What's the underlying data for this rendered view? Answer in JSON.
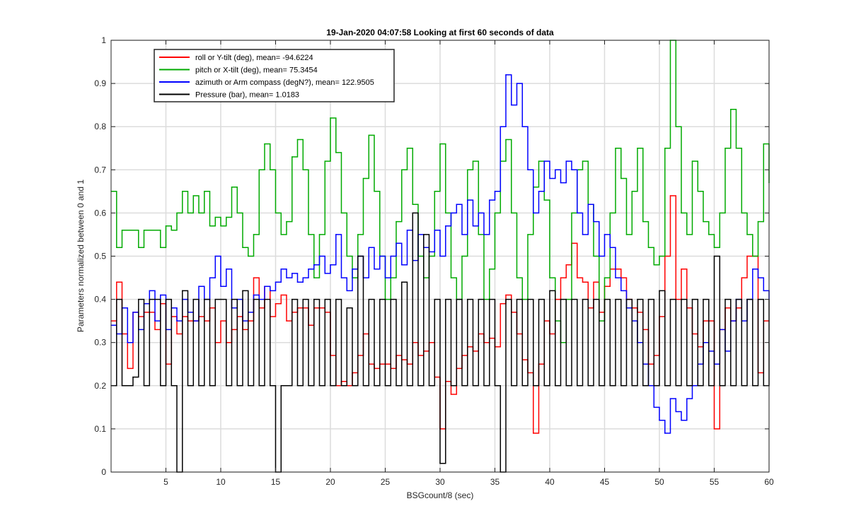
{
  "chart_data": {
    "type": "line",
    "title": "19-Jan-2020 04:07:58 Looking at first 60 seconds of data",
    "xlabel": "BSGcount/8 (sec)",
    "ylabel": "Parameters normalized between 0 and 1",
    "xlim": [
      0,
      60
    ],
    "ylim": [
      0,
      1
    ],
    "xticks": [
      5,
      10,
      15,
      20,
      25,
      30,
      35,
      40,
      45,
      50,
      55,
      60
    ],
    "yticks": [
      0,
      0.1,
      0.2,
      0.3,
      0.4,
      0.5,
      0.6,
      0.7,
      0.8,
      0.9,
      1
    ],
    "xtick_labels": [
      "5",
      "10",
      "15",
      "20",
      "25",
      "30",
      "35",
      "40",
      "45",
      "50",
      "55",
      "60"
    ],
    "ytick_labels": [
      "0",
      "0.1",
      "0.2",
      "0.3",
      "0.4",
      "0.5",
      "0.6",
      "0.7",
      "0.8",
      "0.9",
      "1"
    ],
    "grid": true,
    "legend_position": "top-left",
    "series": [
      {
        "name": "roll or Y-tilt (deg), mean= -94.6224",
        "color": "#ff0000",
        "x": [
          0,
          0.5,
          1,
          1.5,
          2,
          2.5,
          3,
          3.5,
          4,
          4.5,
          5,
          5.5,
          6,
          6.5,
          7,
          7.5,
          8,
          8.5,
          9,
          9.5,
          10,
          10.5,
          11,
          11.5,
          12,
          12.5,
          13,
          13.5,
          14,
          14.5,
          15,
          15.5,
          16,
          16.5,
          17,
          17.5,
          18,
          18.5,
          19,
          19.5,
          20,
          20.5,
          21,
          21.5,
          22,
          22.5,
          23,
          23.5,
          24,
          24.5,
          25,
          25.5,
          26,
          26.5,
          27,
          27.5,
          28,
          28.5,
          29,
          29.5,
          30,
          30.5,
          31,
          31.5,
          32,
          32.5,
          33,
          33.5,
          34,
          34.5,
          35,
          35.5,
          36,
          36.5,
          37,
          37.5,
          38,
          38.5,
          39,
          39.5,
          40,
          40.5,
          41,
          41.5,
          42,
          42.5,
          43,
          43.5,
          44,
          44.5,
          45,
          45.5,
          46,
          46.5,
          47,
          47.5,
          48,
          48.5,
          49,
          49.5,
          50,
          50.5,
          51,
          51.5,
          52,
          52.5,
          53,
          53.5,
          54,
          54.5,
          55,
          55.5,
          56,
          56.5,
          57,
          57.5,
          58,
          58.5,
          59,
          59.5,
          60
        ],
        "values": [
          0.35,
          0.44,
          0.32,
          0.24,
          0.37,
          0.36,
          0.37,
          0.37,
          0.33,
          0.39,
          0.25,
          0.36,
          0.32,
          0.36,
          0.35,
          0.35,
          0.36,
          0.35,
          0.38,
          0.3,
          0.35,
          0.3,
          0.33,
          0.36,
          0.33,
          0.35,
          0.45,
          0.38,
          0.43,
          0.36,
          0.39,
          0.41,
          0.35,
          0.37,
          0.38,
          0.38,
          0.34,
          0.38,
          0.38,
          0.37,
          0.27,
          0.2,
          0.21,
          0.2,
          0.23,
          0.27,
          0.32,
          0.25,
          0.24,
          0.25,
          0.25,
          0.24,
          0.27,
          0.26,
          0.25,
          0.3,
          0.27,
          0.28,
          0.3,
          0.22,
          0.1,
          0.21,
          0.18,
          0.24,
          0.27,
          0.29,
          0.28,
          0.32,
          0.3,
          0.31,
          0.29,
          0.39,
          0.41,
          0.37,
          0.32,
          0.26,
          0.23,
          0.09,
          0.25,
          0.35,
          0.32,
          0.4,
          0.45,
          0.48,
          0.53,
          0.45,
          0.44,
          0.38,
          0.44,
          0.37,
          0.43,
          0.47,
          0.47,
          0.45,
          0.4,
          0.38,
          0.37,
          0.33,
          0.25,
          0.27,
          0.36,
          0.5,
          0.64,
          0.4,
          0.47,
          0.38,
          0.32,
          0.29,
          0.35,
          0.35,
          0.1,
          0.33,
          0.38,
          0.35,
          0.38,
          0.45,
          0.5,
          0.5,
          0.23,
          0.35,
          0.35
        ]
      },
      {
        "name": "pitch or X-tilt (deg), mean= 75.3454",
        "color": "#00aa00",
        "x": [
          0,
          0.5,
          1,
          1.5,
          2,
          2.5,
          3,
          3.5,
          4,
          4.5,
          5,
          5.5,
          6,
          6.5,
          7,
          7.5,
          8,
          8.5,
          9,
          9.5,
          10,
          10.5,
          11,
          11.5,
          12,
          12.5,
          13,
          13.5,
          14,
          14.5,
          15,
          15.5,
          16,
          16.5,
          17,
          17.5,
          18,
          18.5,
          19,
          19.5,
          20,
          20.5,
          21,
          21.5,
          22,
          22.5,
          23,
          23.5,
          24,
          24.5,
          25,
          25.5,
          26,
          26.5,
          27,
          27.5,
          28,
          28.5,
          29,
          29.5,
          30,
          30.5,
          31,
          31.5,
          32,
          32.5,
          33,
          33.5,
          34,
          34.5,
          35,
          35.5,
          36,
          36.5,
          37,
          37.5,
          38,
          38.5,
          39,
          39.5,
          40,
          40.5,
          41,
          41.5,
          42,
          42.5,
          43,
          43.5,
          44,
          44.5,
          45,
          45.5,
          46,
          46.5,
          47,
          47.5,
          48,
          48.5,
          49,
          49.5,
          50,
          50.5,
          51,
          51.5,
          52,
          52.5,
          53,
          53.5,
          54,
          54.5,
          55,
          55.5,
          56,
          56.5,
          57,
          57.5,
          58,
          58.5,
          59,
          59.5,
          60
        ],
        "values": [
          0.65,
          0.52,
          0.56,
          0.56,
          0.56,
          0.52,
          0.56,
          0.56,
          0.56,
          0.52,
          0.57,
          0.56,
          0.6,
          0.65,
          0.6,
          0.64,
          0.6,
          0.65,
          0.57,
          0.59,
          0.57,
          0.59,
          0.66,
          0.6,
          0.52,
          0.5,
          0.55,
          0.7,
          0.76,
          0.7,
          0.6,
          0.55,
          0.58,
          0.73,
          0.77,
          0.7,
          0.55,
          0.45,
          0.55,
          0.72,
          0.82,
          0.74,
          0.6,
          0.5,
          0.45,
          0.55,
          0.68,
          0.78,
          0.65,
          0.5,
          0.4,
          0.45,
          0.58,
          0.7,
          0.75,
          0.62,
          0.5,
          0.45,
          0.5,
          0.65,
          0.76,
          0.6,
          0.45,
          0.4,
          0.5,
          0.7,
          0.72,
          0.55,
          0.4,
          0.47,
          0.6,
          0.72,
          0.77,
          0.6,
          0.45,
          0.4,
          0.55,
          0.66,
          0.72,
          0.63,
          0.45,
          0.35,
          0.3,
          0.4,
          0.6,
          0.7,
          0.72,
          0.62,
          0.5,
          0.35,
          0.45,
          0.6,
          0.75,
          0.68,
          0.55,
          0.65,
          0.75,
          0.58,
          0.52,
          0.48,
          0.5,
          0.75,
          1.0,
          0.8,
          0.6,
          0.55,
          0.72,
          0.65,
          0.58,
          0.55,
          0.52,
          0.6,
          0.75,
          0.84,
          0.75,
          0.6,
          0.55,
          0.5,
          0.58,
          0.76,
          0.67
        ]
      },
      {
        "name": "azimuth or Arm compass (degN?), mean= 122.9505",
        "color": "#0000ff",
        "x": [
          0,
          0.5,
          1,
          1.5,
          2,
          2.5,
          3,
          3.5,
          4,
          4.5,
          5,
          5.5,
          6,
          6.5,
          7,
          7.5,
          8,
          8.5,
          9,
          9.5,
          10,
          10.5,
          11,
          11.5,
          12,
          12.5,
          13,
          13.5,
          14,
          14.5,
          15,
          15.5,
          16,
          16.5,
          17,
          17.5,
          18,
          18.5,
          19,
          19.5,
          20,
          20.5,
          21,
          21.5,
          22,
          22.5,
          23,
          23.5,
          24,
          24.5,
          25,
          25.5,
          26,
          26.5,
          27,
          27.5,
          28,
          28.5,
          29,
          29.5,
          30,
          30.5,
          31,
          31.5,
          32,
          32.5,
          33,
          33.5,
          34,
          34.5,
          35,
          35.5,
          36,
          36.5,
          37,
          37.5,
          38,
          38.5,
          39,
          39.5,
          40,
          40.5,
          41,
          41.5,
          42,
          42.5,
          43,
          43.5,
          44,
          44.5,
          45,
          45.5,
          46,
          46.5,
          47,
          47.5,
          48,
          48.5,
          49,
          49.5,
          50,
          50.5,
          51,
          51.5,
          52,
          52.5,
          53,
          53.5,
          54,
          54.5,
          55,
          55.5,
          56,
          56.5,
          57,
          57.5,
          58,
          58.5,
          59,
          59.5,
          60
        ],
        "values": [
          0.34,
          0.32,
          0.38,
          0.3,
          0.37,
          0.33,
          0.39,
          0.42,
          0.35,
          0.41,
          0.33,
          0.38,
          0.35,
          0.4,
          0.37,
          0.35,
          0.43,
          0.4,
          0.45,
          0.5,
          0.43,
          0.47,
          0.38,
          0.4,
          0.35,
          0.37,
          0.41,
          0.4,
          0.43,
          0.42,
          0.44,
          0.47,
          0.45,
          0.46,
          0.44,
          0.45,
          0.47,
          0.48,
          0.5,
          0.46,
          0.48,
          0.55,
          0.45,
          0.42,
          0.47,
          0.5,
          0.45,
          0.52,
          0.47,
          0.5,
          0.45,
          0.5,
          0.53,
          0.48,
          0.56,
          0.49,
          0.55,
          0.52,
          0.51,
          0.56,
          0.5,
          0.57,
          0.6,
          0.62,
          0.55,
          0.63,
          0.57,
          0.6,
          0.55,
          0.63,
          0.65,
          0.8,
          0.92,
          0.85,
          0.9,
          0.8,
          0.7,
          0.6,
          0.65,
          0.72,
          0.68,
          0.7,
          0.67,
          0.72,
          0.7,
          0.6,
          0.55,
          0.62,
          0.58,
          0.5,
          0.55,
          0.52,
          0.45,
          0.42,
          0.38,
          0.35,
          0.3,
          0.25,
          0.2,
          0.15,
          0.12,
          0.09,
          0.17,
          0.14,
          0.12,
          0.17,
          0.2,
          0.25,
          0.3,
          0.28,
          0.25,
          0.33,
          0.28,
          0.35,
          0.4,
          0.35,
          0.4,
          0.47,
          0.45,
          0.42,
          0.4
        ]
      },
      {
        "name": "Pressure (bar), mean= 1.0183",
        "color": "#000000",
        "x": [
          0,
          0.5,
          1,
          1.5,
          2,
          2.5,
          3,
          3.5,
          4,
          4.5,
          5,
          5.5,
          6,
          6.5,
          7,
          7.5,
          8,
          8.5,
          9,
          9.5,
          10,
          10.5,
          11,
          11.5,
          12,
          12.5,
          13,
          13.5,
          14,
          14.5,
          15,
          15.5,
          16,
          16.5,
          17,
          17.5,
          18,
          18.5,
          19,
          19.5,
          20,
          20.5,
          21,
          21.5,
          22,
          22.5,
          23,
          23.5,
          24,
          24.5,
          25,
          25.5,
          26,
          26.5,
          27,
          27.5,
          28,
          28.5,
          29,
          29.5,
          30,
          30.5,
          31,
          31.5,
          32,
          32.5,
          33,
          33.5,
          34,
          34.5,
          35,
          35.5,
          36,
          36.5,
          37,
          37.5,
          38,
          38.5,
          39,
          39.5,
          40,
          40.5,
          41,
          41.5,
          42,
          42.5,
          43,
          43.5,
          44,
          44.5,
          45,
          45.5,
          46,
          46.5,
          47,
          47.5,
          48,
          48.5,
          49,
          49.5,
          50,
          50.5,
          51,
          51.5,
          52,
          52.5,
          53,
          53.5,
          54,
          54.5,
          55,
          55.5,
          56,
          56.5,
          57,
          57.5,
          58,
          58.5,
          59,
          59.5,
          60
        ],
        "values": [
          0.2,
          0.4,
          0.2,
          0.2,
          0.22,
          0.4,
          0.2,
          0.4,
          0.4,
          0.2,
          0.4,
          0.2,
          0.0,
          0.42,
          0.2,
          0.4,
          0.2,
          0.4,
          0.2,
          0.4,
          0.4,
          0.2,
          0.4,
          0.2,
          0.42,
          0.2,
          0.4,
          0.2,
          0.4,
          0.2,
          0.0,
          0.2,
          0.2,
          0.4,
          0.2,
          0.4,
          0.2,
          0.4,
          0.2,
          0.4,
          0.2,
          0.4,
          0.2,
          0.38,
          0.2,
          0.5,
          0.2,
          0.4,
          0.2,
          0.4,
          0.2,
          0.4,
          0.2,
          0.44,
          0.2,
          0.6,
          0.2,
          0.55,
          0.2,
          0.4,
          0.02,
          0.4,
          0.2,
          0.4,
          0.2,
          0.4,
          0.2,
          0.4,
          0.2,
          0.4,
          0.2,
          0.0,
          0.4,
          0.2,
          0.4,
          0.2,
          0.4,
          0.2,
          0.4,
          0.2,
          0.42,
          0.2,
          0.4,
          0.2,
          0.4,
          0.2,
          0.4,
          0.2,
          0.4,
          0.2,
          0.4,
          0.2,
          0.4,
          0.2,
          0.4,
          0.2,
          0.4,
          0.2,
          0.4,
          0.2,
          0.42,
          0.2,
          0.4,
          0.2,
          0.4,
          0.2,
          0.4,
          0.2,
          0.4,
          0.2,
          0.5,
          0.2,
          0.4,
          0.2,
          0.4,
          0.2,
          0.4,
          0.2,
          0.4,
          0.2,
          0.4
        ]
      }
    ]
  }
}
